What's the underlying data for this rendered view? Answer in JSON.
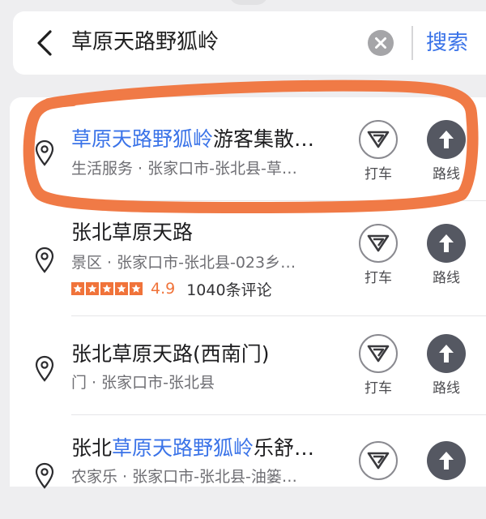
{
  "search": {
    "query": "草原天路野狐岭",
    "submit_label": "搜索"
  },
  "results": [
    {
      "title_highlight": "草原天路野狐岭",
      "title_rest": "游客集散…",
      "subtitle": "生活服务 · 张家口市-张北县-草…",
      "taxi_label": "打车",
      "route_label": "路线",
      "circled": true
    },
    {
      "title_highlight": "",
      "title_rest": "张北草原天路",
      "subtitle": "景区 · 张家口市-张北县-023乡…",
      "rating": {
        "stars": 5,
        "score": "4.9",
        "reviews": "1040条评论"
      },
      "taxi_label": "打车",
      "route_label": "路线"
    },
    {
      "title_highlight": "",
      "title_rest": "张北草原天路(西南门)",
      "subtitle": "门 · 张家口市-张北县",
      "taxi_label": "打车",
      "route_label": "路线"
    },
    {
      "title_prefix": "张北",
      "title_highlight": "草原天路野狐岭",
      "title_rest": "乐舒…",
      "subtitle": "农家乐 · 张家口市-张北县-油篓…",
      "taxi_label": "打车",
      "route_label": "路线"
    }
  ],
  "colors": {
    "accent_blue": "#3a73e8",
    "rating_orange": "#f0733a",
    "annotation_orange": "#f07a46"
  },
  "icons": {
    "back": "chevron-left-icon",
    "clear": "clear-x-icon",
    "pin": "location-pin-icon",
    "taxi": "taxi-triangle-icon",
    "route": "route-arrow-icon"
  }
}
